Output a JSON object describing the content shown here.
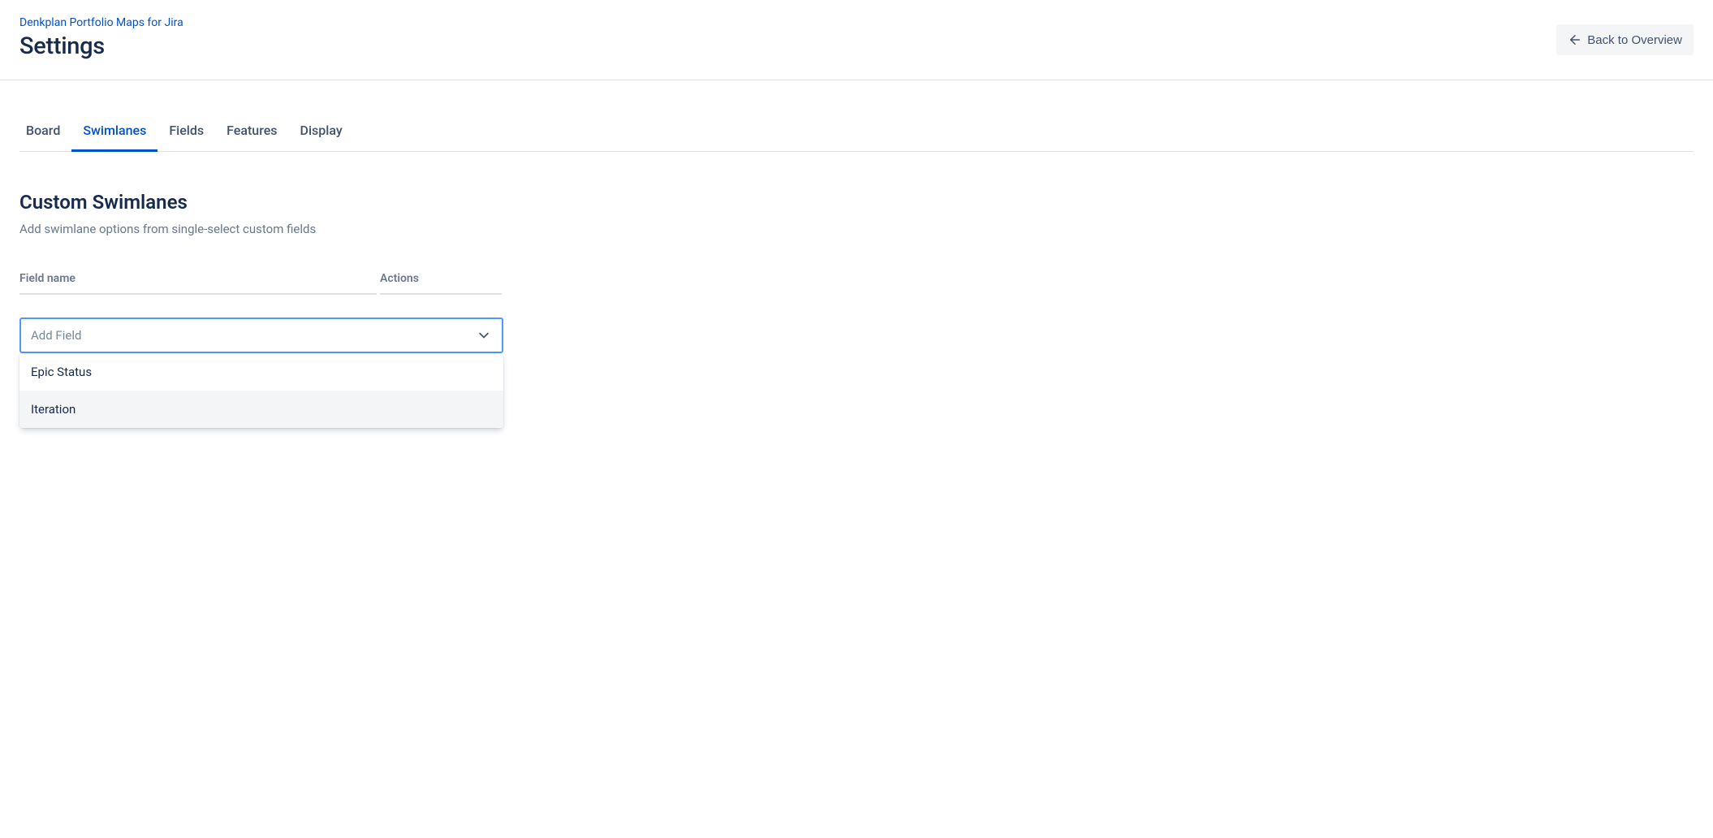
{
  "header": {
    "breadcrumb": "Denkplan Portfolio Maps for Jira",
    "title": "Settings",
    "back_button_label": "Back to Overview"
  },
  "tabs": [
    {
      "label": "Board",
      "active": false
    },
    {
      "label": "Swimlanes",
      "active": true
    },
    {
      "label": "Fields",
      "active": false
    },
    {
      "label": "Features",
      "active": false
    },
    {
      "label": "Display",
      "active": false
    }
  ],
  "section": {
    "title": "Custom Swimlanes",
    "description": "Add swimlane options from single-select custom fields"
  },
  "table": {
    "columns": {
      "field_name": "Field name",
      "actions": "Actions"
    }
  },
  "select": {
    "placeholder": "Add Field",
    "options": [
      {
        "label": "Epic Status",
        "hovered": false
      },
      {
        "label": "Iteration",
        "hovered": true
      }
    ]
  }
}
